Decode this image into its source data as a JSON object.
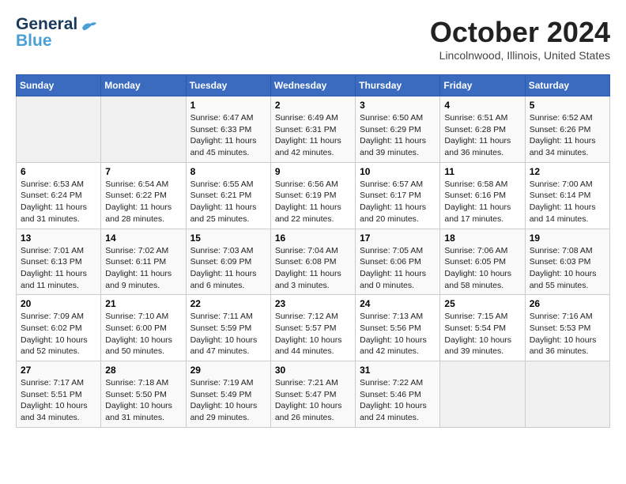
{
  "header": {
    "logo_line1": "General",
    "logo_line2": "Blue",
    "month": "October 2024",
    "location": "Lincolnwood, Illinois, United States"
  },
  "weekdays": [
    "Sunday",
    "Monday",
    "Tuesday",
    "Wednesday",
    "Thursday",
    "Friday",
    "Saturday"
  ],
  "weeks": [
    [
      {
        "day": null
      },
      {
        "day": null
      },
      {
        "day": "1",
        "sunrise": "6:47 AM",
        "sunset": "6:33 PM",
        "daylight": "11 hours and 45 minutes."
      },
      {
        "day": "2",
        "sunrise": "6:49 AM",
        "sunset": "6:31 PM",
        "daylight": "11 hours and 42 minutes."
      },
      {
        "day": "3",
        "sunrise": "6:50 AM",
        "sunset": "6:29 PM",
        "daylight": "11 hours and 39 minutes."
      },
      {
        "day": "4",
        "sunrise": "6:51 AM",
        "sunset": "6:28 PM",
        "daylight": "11 hours and 36 minutes."
      },
      {
        "day": "5",
        "sunrise": "6:52 AM",
        "sunset": "6:26 PM",
        "daylight": "11 hours and 34 minutes."
      }
    ],
    [
      {
        "day": "6",
        "sunrise": "6:53 AM",
        "sunset": "6:24 PM",
        "daylight": "11 hours and 31 minutes."
      },
      {
        "day": "7",
        "sunrise": "6:54 AM",
        "sunset": "6:22 PM",
        "daylight": "11 hours and 28 minutes."
      },
      {
        "day": "8",
        "sunrise": "6:55 AM",
        "sunset": "6:21 PM",
        "daylight": "11 hours and 25 minutes."
      },
      {
        "day": "9",
        "sunrise": "6:56 AM",
        "sunset": "6:19 PM",
        "daylight": "11 hours and 22 minutes."
      },
      {
        "day": "10",
        "sunrise": "6:57 AM",
        "sunset": "6:17 PM",
        "daylight": "11 hours and 20 minutes."
      },
      {
        "day": "11",
        "sunrise": "6:58 AM",
        "sunset": "6:16 PM",
        "daylight": "11 hours and 17 minutes."
      },
      {
        "day": "12",
        "sunrise": "7:00 AM",
        "sunset": "6:14 PM",
        "daylight": "11 hours and 14 minutes."
      }
    ],
    [
      {
        "day": "13",
        "sunrise": "7:01 AM",
        "sunset": "6:13 PM",
        "daylight": "11 hours and 11 minutes."
      },
      {
        "day": "14",
        "sunrise": "7:02 AM",
        "sunset": "6:11 PM",
        "daylight": "11 hours and 9 minutes."
      },
      {
        "day": "15",
        "sunrise": "7:03 AM",
        "sunset": "6:09 PM",
        "daylight": "11 hours and 6 minutes."
      },
      {
        "day": "16",
        "sunrise": "7:04 AM",
        "sunset": "6:08 PM",
        "daylight": "11 hours and 3 minutes."
      },
      {
        "day": "17",
        "sunrise": "7:05 AM",
        "sunset": "6:06 PM",
        "daylight": "11 hours and 0 minutes."
      },
      {
        "day": "18",
        "sunrise": "7:06 AM",
        "sunset": "6:05 PM",
        "daylight": "10 hours and 58 minutes."
      },
      {
        "day": "19",
        "sunrise": "7:08 AM",
        "sunset": "6:03 PM",
        "daylight": "10 hours and 55 minutes."
      }
    ],
    [
      {
        "day": "20",
        "sunrise": "7:09 AM",
        "sunset": "6:02 PM",
        "daylight": "10 hours and 52 minutes."
      },
      {
        "day": "21",
        "sunrise": "7:10 AM",
        "sunset": "6:00 PM",
        "daylight": "10 hours and 50 minutes."
      },
      {
        "day": "22",
        "sunrise": "7:11 AM",
        "sunset": "5:59 PM",
        "daylight": "10 hours and 47 minutes."
      },
      {
        "day": "23",
        "sunrise": "7:12 AM",
        "sunset": "5:57 PM",
        "daylight": "10 hours and 44 minutes."
      },
      {
        "day": "24",
        "sunrise": "7:13 AM",
        "sunset": "5:56 PM",
        "daylight": "10 hours and 42 minutes."
      },
      {
        "day": "25",
        "sunrise": "7:15 AM",
        "sunset": "5:54 PM",
        "daylight": "10 hours and 39 minutes."
      },
      {
        "day": "26",
        "sunrise": "7:16 AM",
        "sunset": "5:53 PM",
        "daylight": "10 hours and 36 minutes."
      }
    ],
    [
      {
        "day": "27",
        "sunrise": "7:17 AM",
        "sunset": "5:51 PM",
        "daylight": "10 hours and 34 minutes."
      },
      {
        "day": "28",
        "sunrise": "7:18 AM",
        "sunset": "5:50 PM",
        "daylight": "10 hours and 31 minutes."
      },
      {
        "day": "29",
        "sunrise": "7:19 AM",
        "sunset": "5:49 PM",
        "daylight": "10 hours and 29 minutes."
      },
      {
        "day": "30",
        "sunrise": "7:21 AM",
        "sunset": "5:47 PM",
        "daylight": "10 hours and 26 minutes."
      },
      {
        "day": "31",
        "sunrise": "7:22 AM",
        "sunset": "5:46 PM",
        "daylight": "10 hours and 24 minutes."
      },
      {
        "day": null
      },
      {
        "day": null
      }
    ]
  ]
}
